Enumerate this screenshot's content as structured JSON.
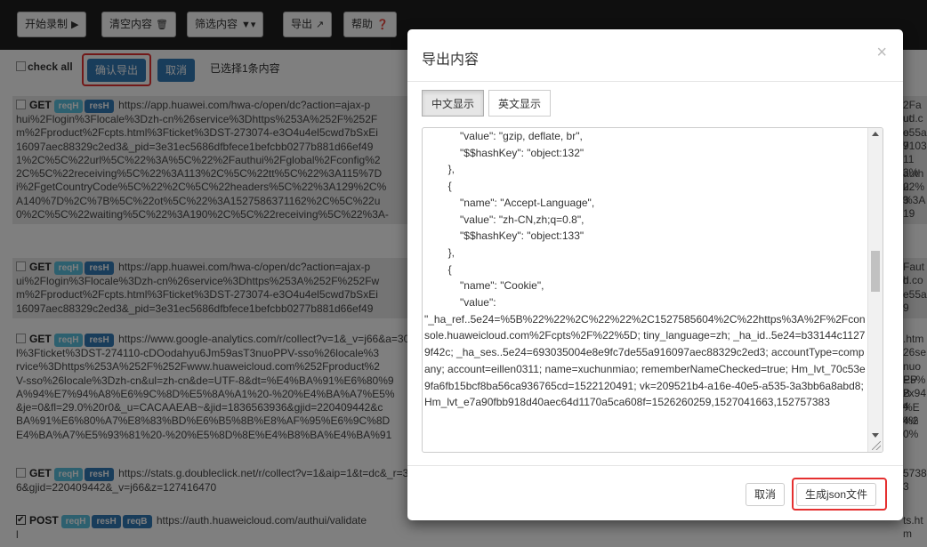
{
  "toolbar": {
    "record": "开始录制",
    "clear": "清空内容",
    "filter": "筛选内容",
    "export": "导出",
    "help": "帮助"
  },
  "actions": {
    "check_all": "check all",
    "confirm_export": "确认导出",
    "cancel": "取消",
    "selected_info": "已选择1条内容"
  },
  "entries": [
    {
      "method": "GET",
      "labels": [
        "reqH",
        "resH"
      ],
      "lines_left": [
        "https://app.huawei.com/hwa-c/open/dc?action=ajax-p",
        "hui%2Flogin%3Flocale%3Dzh-cn%26service%3Dhttps%253A%252F%252F",
        "m%2Fproduct%2Fcpts.html%3Fticket%3DST-273074-e3O4u4el5cwd7bSxEi",
        "16097aec88329c2ed3&_pid=3e31ec5686dfbfece1befcbb0277b881d66ef49",
        "1%2C%5C%22url%5C%22%3A%5C%22%2Fauthui%2Fglobal%2Fconfig%2",
        "2C%5C%22receiving%5C%22%3A113%2C%5C%22tt%5C%22%3A115%7D",
        "i%2FgetCountryCode%5C%22%2C%5C%22headers%5C%22%3A129%2C%",
        "A140%7D%2C%7B%5C%22ot%5C%22%3A1527586371162%2C%5C%22u",
        "0%2C%5C%22waiting%5C%22%3A190%2C%5C%22receiving%5C%22%3A-"
      ],
      "lines_right": [
        "2Faut",
        "ud.co",
        "e55a9",
        "7103",
        "113%",
        "authu",
        "22%3",
        "%3A19",
        ""
      ]
    },
    {
      "method": "GET",
      "labels": [
        "reqH",
        "resH"
      ],
      "lines_left": [
        "https://app.huawei.com/hwa-c/open/dc?action=ajax-p",
        "ui%2Flogin%3Flocale%3Dzh-cn%26service%3Dhttps%253A%252F%252Fw",
        "m%2Fproduct%2Fcpts.html%3Fticket%3DST-273074-e3O4u4el5cwd7bSxEi",
        "16097aec88329c2ed3&_pid=3e31ec5686dfbfece1befcbb0277b881d66ef49"
      ],
      "lines_right": [
        "Fauth",
        "d.co",
        "e55a9",
        ""
      ]
    },
    {
      "method": "GET",
      "labels": [
        "reqH",
        "resH"
      ],
      "lines_left": [
        "https://www.google-analytics.com/r/collect?v=1&_v=j66&a=30",
        "l%3Fticket%3DST-274110-cDOodahyu6Jm59asT3nuoPPV-sso%26locale%3",
        "rvice%3Dhttps%253A%252F%252Fwww.huaweicloud.com%252Fproduct%2",
        "V-sso%26locale%3Dzh-cn&ul=zh-cn&de=UTF-8&dt=%E4%BA%91%E6%80%9",
        "A%94%E7%94%A8%E6%9C%8D%E5%8A%A1%20-%20%E4%BA%A7%E5%",
        "&je=0&fl=29.0%20r0&_u=CACAAEAB~&jid=1836563936&gjid=220409442&c",
        "BA%91%E6%80%A7%E8%83%BD%E6%B5%8B%E8%AF%95%E6%9C%8D",
        "E4%BA%A7%E5%93%81%20-%20%E5%8D%8E%E4%B8%BA%E4%BA%91"
      ],
      "lines_right": [
        ".htm",
        "26se",
        "nuoPP",
        "E5%B",
        "2x944",
        "%E4%",
        "%20%",
        ""
      ]
    },
    {
      "method": "GET",
      "labels": [
        "reqH",
        "resH"
      ],
      "lines_left": [
        "https://stats.g.doubleclick.net/r/collect?v=1&aip=1&t=dc&_r=3",
        "6&gjid=220409442&_v=j66&z=127416470"
      ],
      "lines_right": [
        "57383",
        ""
      ]
    },
    {
      "method": "POST",
      "labels": [
        "reqH",
        "resH",
        "reqB"
      ],
      "lines_left": [
        "https://auth.huaweicloud.com/authui/validate",
        "l"
      ],
      "lines_right": [
        "ts.htm",
        ""
      ]
    }
  ],
  "modal": {
    "title": "导出内容",
    "close": "×",
    "tab_cn": "中文显示",
    "tab_en": "英文显示",
    "code": "            \"value\": \"gzip, deflate, br\",\n            \"$$hashKey\": \"object:132\"\n        },\n        {\n            \"name\": \"Accept-Language\",\n            \"value\": \"zh-CN,zh;q=0.8\",\n            \"$$hashKey\": \"object:133\"\n        },\n        {\n            \"name\": \"Cookie\",\n            \"value\":\n\"_ha_ref..5e24=%5B%22%22%2C%22%22%2C1527585604%2C%22https%3A%2F%2Fconsole.huaweicloud.com%2Fcpts%2F%22%5D; tiny_language=zh; _ha_id..5e24=b33144c11279f42c; _ha_ses..5e24=693035004e8e9fc7de55a916097aec88329c2ed3; accountType=company; account=eillen0311; name=xuchunmiao; rememberNameChecked=true; Hm_lvt_70c53e9fa6fb15bcf8ba56ca936765cd=1522120491; vk=209521b4-a16e-40e5-a535-3a3bb6a8abd8; Hm_lvt_e7a90fbb918d40aec64d1170a5ca608f=1526260259,1527041663,152757383",
    "cancel": "取消",
    "generate": "生成json文件"
  },
  "colors": {
    "accent": "#337ab7",
    "label_teal": "#5bc0de",
    "highlight": "#e53030"
  }
}
